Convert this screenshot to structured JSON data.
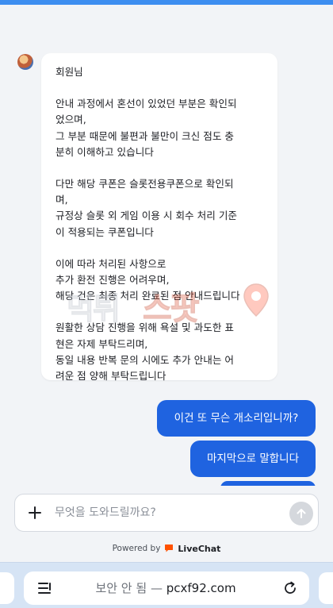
{
  "agent_message": {
    "paragraphs": [
      [
        "회원님"
      ],
      [
        "안내 과정에서 혼선이 있었던 부분은 확인되",
        "었으며,",
        "그 부분 때문에 불편과 불만이 크신 점도 충",
        "분히 이해하고 있습니다"
      ],
      [
        "다만 해당 쿠폰은 슬롯전용쿠폰으로 확인되",
        "며,",
        "규정상 슬롯 외 게임 이용 시 회수 처리 기준",
        "이 적용되는 쿠폰입니다"
      ],
      [
        "이에 따라 처리된 사항으로",
        "추가 환전 진행은 어려우며,",
        "해당 건은 최종 처리 완료된 점 안내드립니다"
      ],
      [
        "원활한 상담 진행을 위해 욕설 및 과도한 표",
        "현은 자제 부탁드리며,",
        "동일 내용 반복 문의 시에도 추가 안내는 어",
        "려운 점 양해 부탁드립니다"
      ]
    ]
  },
  "watermark": {
    "part_a": "먹튀",
    "part_b": "스팟"
  },
  "user_messages": [
    "이건 또 무슨 개소리입니까?",
    "마지막으로 말합니다",
    ""
  ],
  "composer": {
    "placeholder": "무엇을 도와드릴까요?",
    "value": ""
  },
  "powered_by": {
    "prefix": "Powered by",
    "brand": "LiveChat"
  },
  "browser": {
    "security_label": "보안 안 됨 —",
    "domain": "pcxf92.com"
  },
  "colors": {
    "accent": "#1f63e0",
    "livechat": "#ff5100",
    "browser_bar": "#d6e4f5"
  }
}
